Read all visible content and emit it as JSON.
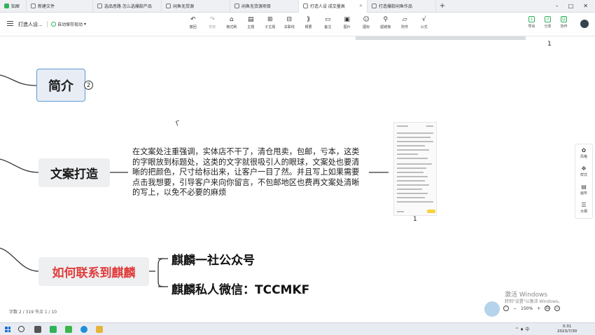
{
  "browser_tabs": [
    {
      "label": "知犀",
      "active": false
    },
    {
      "label": "新建文件",
      "active": false
    },
    {
      "label": "选品思路 怎么选爆款产品",
      "active": false
    },
    {
      "label": "闲鱼无货源",
      "active": false
    },
    {
      "label": "闲鱼无货源项目",
      "active": false
    },
    {
      "label": "打造人设 成交量高",
      "active": true
    },
    {
      "label": "打造爆款闲鱼作品",
      "active": false
    }
  ],
  "window_controls": {
    "new_tab": "+",
    "minimize": "–",
    "maximize": "□",
    "close": "✕"
  },
  "header": {
    "doc_title": "打造人设...",
    "autosave": "自动保存现动",
    "autosave_arrow": "▾"
  },
  "tools": [
    {
      "glyph": "↶",
      "label": "撤回",
      "dim": false
    },
    {
      "glyph": "↷",
      "label": "恢复",
      "dim": true
    },
    {
      "glyph": "⌂",
      "label": "格式刷",
      "dim": false
    },
    {
      "glyph": "▤",
      "label": "主题",
      "dim": false
    },
    {
      "glyph": "⊞",
      "label": "子主题",
      "dim": false
    },
    {
      "glyph": "⊟",
      "label": "关联线",
      "dim": false
    },
    {
      "glyph": "⟫",
      "label": "概要",
      "dim": false
    },
    {
      "glyph": "▭",
      "label": "备注",
      "dim": false
    },
    {
      "glyph": "▣",
      "label": "图片",
      "dim": false
    },
    {
      "glyph": "☺",
      "label": "图标",
      "dim": false
    },
    {
      "glyph": "⚲",
      "label": "超链接",
      "dim": false
    },
    {
      "glyph": "▱",
      "label": "附件",
      "dim": false
    },
    {
      "glyph": "√",
      "label": "公式",
      "dim": false
    }
  ],
  "right_tools": [
    {
      "glyph": "↓",
      "label": "导出"
    },
    {
      "glyph": "↗",
      "label": "分享"
    },
    {
      "glyph": "☺",
      "label": "协作"
    }
  ],
  "page_numbers": {
    "top": "1",
    "phone": "1"
  },
  "mindmap": {
    "intro_node": "简介",
    "intro_badge": "2",
    "copy_node": "文案打造",
    "copy_desc": "在文案处注重强调，实体店不干了，清仓甩卖，包邮，亏本，这类的字眼放到标题处，这类的文字就很吸引人的眼球，文案处也要清晰的把颜色，尺寸给标出来，让客户一目了然。并且写上如果需要点击我想要，引导客户来向你留言，不包邮地区也费再文案处清晰的写上，以免不必要的麻烦",
    "contact_node": "如何联系到麒麟",
    "contact_children": [
      "麒麟一社公众号",
      "麒麟私人微信：TCCMKF"
    ]
  },
  "side_panel": [
    {
      "glyph": "✿",
      "label": "风格"
    },
    {
      "glyph": "✥",
      "label": "样式"
    },
    {
      "glyph": "▤",
      "label": "画布"
    },
    {
      "glyph": "☰",
      "label": "大纲"
    }
  ],
  "status": {
    "text": "字数 2 / 319    节点 1 / 10"
  },
  "watermark": {
    "line1": "激活 Windows",
    "line2": "转到\"设置\"以激活 Windows。"
  },
  "zoom": {
    "minus": "−",
    "value": "150%",
    "plus": "+"
  },
  "colors": {
    "accent": "#2fb35a",
    "contact_red": "#e03b3b",
    "intro_border": "#5b9bd5"
  },
  "taskbar": {
    "tray": "^  ♦  中",
    "time": "0:31",
    "date": "2023/7/30"
  }
}
